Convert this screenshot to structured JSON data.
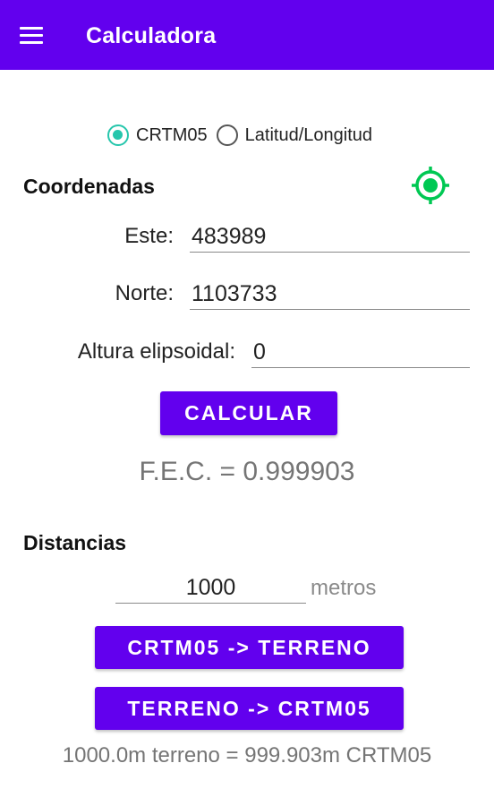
{
  "appbar": {
    "title": "Calculadora",
    "menu_icon": "hamburger-menu-icon",
    "color": "#6200ee"
  },
  "coord_system": {
    "options": [
      {
        "label": "CRTM05",
        "selected": true
      },
      {
        "label": "Latitud/Longitud",
        "selected": false
      }
    ],
    "selected_color": "#26c6ac"
  },
  "coordenadas": {
    "title": "Coordenadas",
    "location_icon": "gps-crosshair-icon",
    "location_icon_color": "#00c853",
    "este": {
      "label": "Este:",
      "value": "483989"
    },
    "norte": {
      "label": "Norte:",
      "value": "1103733"
    },
    "altura": {
      "label": "Altura elipsoidal:",
      "value": "0"
    },
    "calcular_label": "CALCULAR",
    "fec_text": "F.E.C. = 0.999903"
  },
  "distancias": {
    "title": "Distancias",
    "distance": {
      "value": "1000",
      "unit": "metros"
    },
    "to_terreno_label": "CRTM05 -> TERRENO",
    "to_crtm_label": "TERRENO -> CRTM05",
    "result_text": "1000.0m terreno = 999.903m CRTM05"
  }
}
